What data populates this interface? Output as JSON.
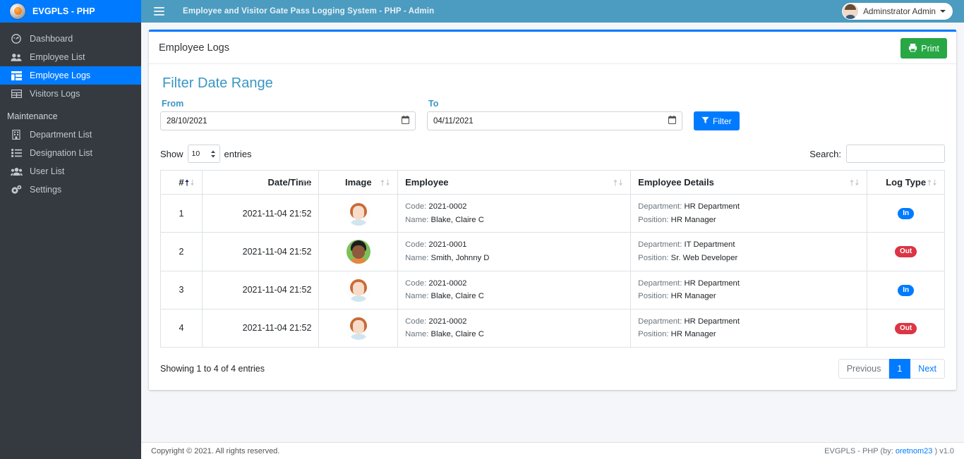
{
  "brand": {
    "title": "EVGPLS - PHP",
    "logo_icon": "globe-logo-icon"
  },
  "sidebar": {
    "items": [
      {
        "label": "Dashboard",
        "icon": "tachometer-icon",
        "active": false
      },
      {
        "label": "Employee List",
        "icon": "users-icon",
        "active": false
      },
      {
        "label": "Employee Logs",
        "icon": "table-columns-icon",
        "active": true
      },
      {
        "label": "Visitors Logs",
        "icon": "table-grid-icon",
        "active": false
      }
    ],
    "section_header": "Maintenance",
    "maintenance_items": [
      {
        "label": "Department List",
        "icon": "building-icon"
      },
      {
        "label": "Designation List",
        "icon": "list-ul-icon"
      },
      {
        "label": "User List",
        "icon": "user-group-icon"
      },
      {
        "label": "Settings",
        "icon": "gears-icon"
      }
    ]
  },
  "navbar": {
    "menu_icon": "hamburger-icon",
    "title": "Employee and Visitor Gate Pass Logging System - PHP - Admin",
    "user_name": "Adminstrator Admin",
    "avatar_icon": "user-avatar-icon",
    "caret_icon": "caret-down-icon"
  },
  "card": {
    "title": "Employee Logs",
    "print_label": "Print",
    "print_icon": "printer-icon"
  },
  "filter": {
    "heading": "Filter Date Range",
    "from_label": "From",
    "from_value": "28/10/2021",
    "to_label": "To",
    "to_value": "04/11/2021",
    "calendar_icon": "calendar-icon",
    "button_label": "Filter",
    "button_icon": "funnel-icon"
  },
  "datatable": {
    "show_label": "Show",
    "length_value": "10",
    "entries_label": "entries",
    "search_label": "Search:",
    "search_value": "",
    "search_placeholder": "",
    "columns": [
      {
        "label": "#",
        "sort": "asc"
      },
      {
        "label": "Date/Time",
        "sort": "none"
      },
      {
        "label": "Image",
        "sort": "none"
      },
      {
        "label": "Employee",
        "sort": "none"
      },
      {
        "label": "Employee Details",
        "sort": "none"
      },
      {
        "label": "Log Type",
        "sort": "none"
      }
    ],
    "rows": [
      {
        "index": "1",
        "datetime": "2021-11-04 21:52",
        "avatar": "female-avatar-icon",
        "code_label": "Code:",
        "code": "2021-0002",
        "name_label": "Name:",
        "name": "Blake, Claire C",
        "department_label": "Department:",
        "department": "HR Department",
        "position_label": "Position:",
        "position": "HR Manager",
        "log_type": "In",
        "log_color": "#007bff"
      },
      {
        "index": "2",
        "datetime": "2021-11-04 21:52",
        "avatar": "male-avatar-icon",
        "code_label": "Code:",
        "code": "2021-0001",
        "name_label": "Name:",
        "name": "Smith, Johnny D",
        "department_label": "Department:",
        "department": "IT Department",
        "position_label": "Position:",
        "position": "Sr. Web Developer",
        "log_type": "Out",
        "log_color": "#dc3545"
      },
      {
        "index": "3",
        "datetime": "2021-11-04 21:52",
        "avatar": "female-avatar-icon",
        "code_label": "Code:",
        "code": "2021-0002",
        "name_label": "Name:",
        "name": "Blake, Claire C",
        "department_label": "Department:",
        "department": "HR Department",
        "position_label": "Position:",
        "position": "HR Manager",
        "log_type": "In",
        "log_color": "#007bff"
      },
      {
        "index": "4",
        "datetime": "2021-11-04 21:52",
        "avatar": "female-avatar-icon",
        "code_label": "Code:",
        "code": "2021-0002",
        "name_label": "Name:",
        "name": "Blake, Claire C",
        "department_label": "Department:",
        "department": "HR Department",
        "position_label": "Position:",
        "position": "HR Manager",
        "log_type": "Out",
        "log_color": "#dc3545"
      }
    ],
    "info": "Showing 1 to 4 of 4 entries",
    "pagination": {
      "previous": "Previous",
      "current": "1",
      "next": "Next"
    }
  },
  "footer": {
    "copyright": "Copyright © 2021. All rights reserved.",
    "right_prefix": "EVGPLS - PHP (by: ",
    "right_link": "oretnom23",
    "right_suffix": " ) v1.0"
  },
  "colors": {
    "sidebar_bg": "#343a40",
    "brand_bg": "#007bff",
    "navbar_bg": "#4b9cc0",
    "accent": "#007bff",
    "filter_heading": "#3a96c4",
    "print_green": "#28a745",
    "danger": "#dc3545",
    "page_bg": "#f4f6f9"
  }
}
